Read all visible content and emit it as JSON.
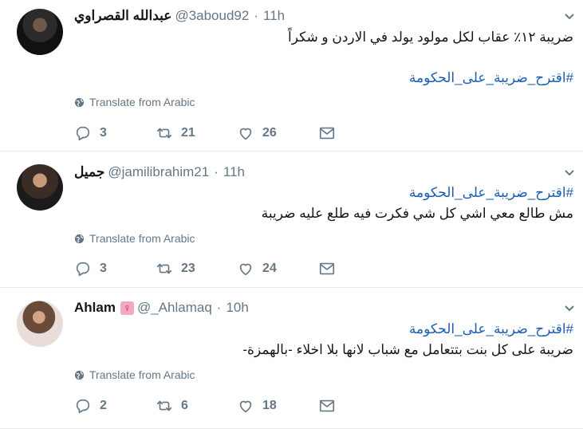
{
  "tweets": [
    {
      "name": "عبدالله القصراوي",
      "handle": "@3aboud92",
      "time": "11h",
      "line1": "ضريبة ١٢٪ عقاب لكل مولود يولد في الاردن و شكراً",
      "hashtag": "#اقترح_ضريبة_على_الحكومة",
      "translate": "Translate from Arabic",
      "replies": "3",
      "retweets": "21",
      "likes": "26"
    },
    {
      "name": "جميل",
      "handle": "@jamilibrahim21",
      "time": "11h",
      "hashtag": "#اقترح_ضريبة_على_الحكومة",
      "line1": "مش طالع معي اشي كل شي فكرت فيه طلع عليه ضريبة",
      "translate": "Translate from Arabic",
      "replies": "3",
      "retweets": "23",
      "likes": "24"
    },
    {
      "name": "Ahlam",
      "badge": "♀",
      "handle": "@_Ahlamaq",
      "time": "10h",
      "hashtag": "#اقترح_ضريبة_على_الحكومة",
      "line1": "ضريبة على كل بنت بتتعامل مع شباب لانها بلا اخلاء -بالهمزة-",
      "translate": "Translate from Arabic",
      "replies": "2",
      "retweets": "6",
      "likes": "18"
    }
  ],
  "separator": "·",
  "icons": {
    "reply": "reply-icon",
    "retweet": "retweet-icon",
    "like": "heart-icon",
    "message": "envelope-icon",
    "more": "chevron-down-icon",
    "translate": "globe-icon"
  }
}
